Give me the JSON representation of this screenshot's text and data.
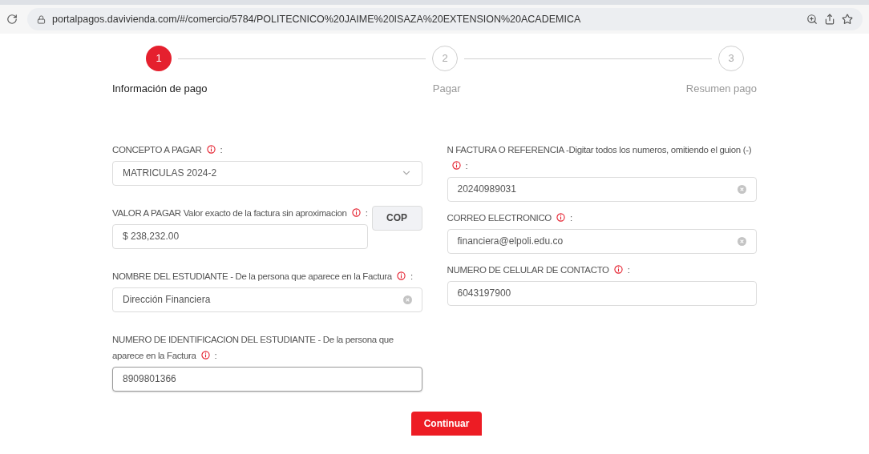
{
  "browser": {
    "url": "portalpagos.davivienda.com/#/comercio/5784/POLITECNICO%20JAIME%20ISAZA%20EXTENSION%20ACADEMICA"
  },
  "steps": [
    {
      "number": "1",
      "label": "Información de pago",
      "selected": true
    },
    {
      "number": "2",
      "label": "Pagar",
      "selected": false
    },
    {
      "number": "3",
      "label": "Resumen pago",
      "selected": false
    }
  ],
  "columns": [
    {
      "fields": [
        {
          "kind": "select",
          "label": "CONCEPTO A PAGAR",
          "value": "MATRICULAS 2024-2",
          "clearable": false,
          "focused": false
        },
        {
          "kind": "currency",
          "label": "VALOR A PAGAR Valor exacto de la factura sin aproximacion",
          "value": "$ 238,232.00",
          "currency": "COP",
          "clearable": false,
          "focused": false
        },
        {
          "kind": "input",
          "label": "NOMBRE DEL ESTUDIANTE - De la persona que aparece en la Factura",
          "value": "Dirección Financiera",
          "clearable": true,
          "focused": false
        },
        {
          "kind": "input",
          "label": "NUMERO DE IDENTIFICACION DEL ESTUDIANTE - De la persona que aparece en la Factura",
          "value": "8909801366",
          "clearable": false,
          "focused": true
        }
      ]
    },
    {
      "fields": [
        {
          "kind": "input",
          "label": "N FACTURA O REFERENCIA -Digitar todos los numeros, omitiendo el guion (-)",
          "value": "20240989031",
          "clearable": true,
          "focused": false
        },
        {
          "kind": "input",
          "label": "CORREO ELECTRONICO",
          "value": "financiera@elpoli.edu.co",
          "clearable": true,
          "focused": false
        },
        {
          "kind": "input",
          "label": "NUMERO DE CELULAR DE CONTACTO",
          "value": "6043197900",
          "clearable": false,
          "focused": false
        }
      ]
    }
  ],
  "colon": ":",
  "submit": "Continuar"
}
